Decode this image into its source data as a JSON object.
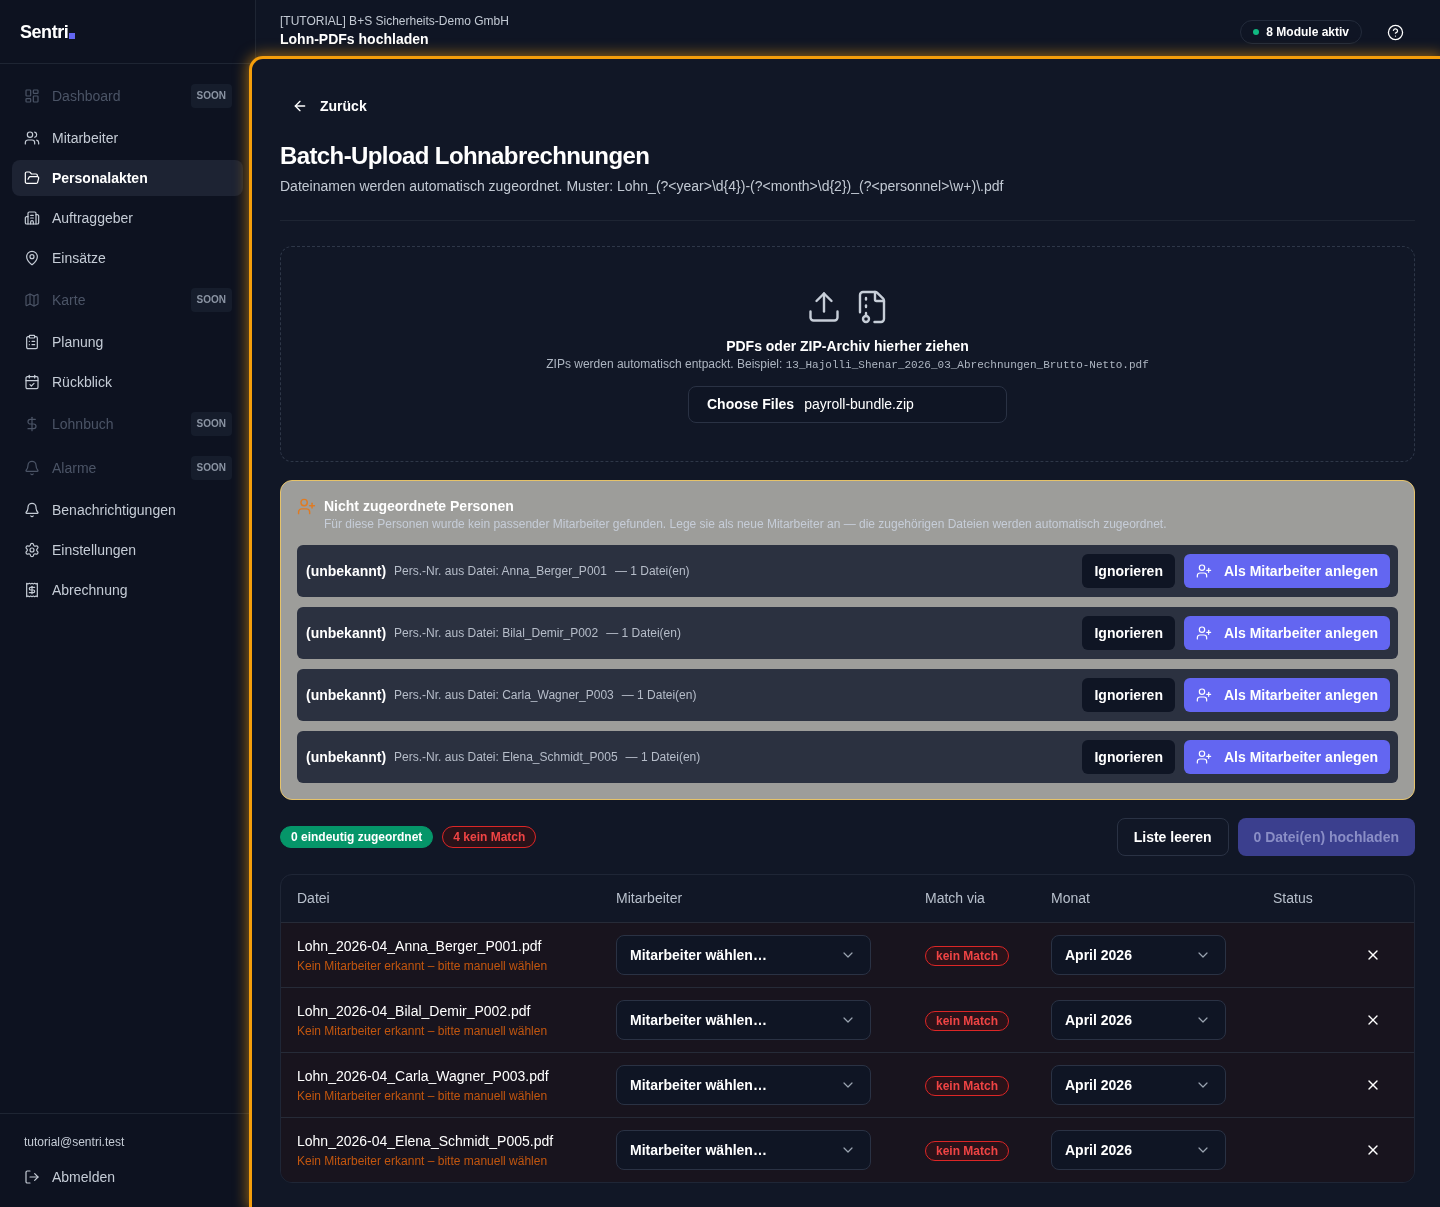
{
  "sidebar": {
    "logo": "Sentri",
    "items": [
      {
        "label": "Dashboard",
        "selected": false,
        "disabled": true,
        "badge": "SOON"
      },
      {
        "label": "Mitarbeiter",
        "selected": false,
        "disabled": false
      },
      {
        "label": "Personalakten",
        "selected": true,
        "disabled": false
      },
      {
        "label": "Auftraggeber",
        "selected": false,
        "disabled": false
      },
      {
        "label": "Einsätze",
        "selected": false,
        "disabled": false
      },
      {
        "label": "Karte",
        "selected": false,
        "disabled": true,
        "badge": "SOON"
      },
      {
        "label": "Planung",
        "selected": false,
        "disabled": false
      },
      {
        "label": "Rückblick",
        "selected": false,
        "disabled": false
      },
      {
        "label": "Lohnbuch",
        "selected": false,
        "disabled": true,
        "badge": "SOON"
      },
      {
        "label": "Alarme",
        "selected": false,
        "disabled": true,
        "badge": "SOON"
      },
      {
        "label": "Benachrichtigungen",
        "selected": false,
        "disabled": false
      },
      {
        "label": "Einstellungen",
        "selected": false,
        "disabled": false
      },
      {
        "label": "Abrechnung",
        "selected": false,
        "disabled": false
      }
    ],
    "user_email": "tutorial@sentri.test",
    "logout": "Abmelden"
  },
  "header": {
    "organization": "[TUTORIAL] B+S Sicherheits-Demo GmbH",
    "title": "Lohn-PDFs hochladen",
    "modules": "8 Module aktiv"
  },
  "page": {
    "back": "Zurück",
    "title": "Batch-Upload Lohnabrechnungen",
    "subtitle": "Dateinamen werden automatisch zugeordnet. Muster: Lohn_(?<year>\\d{4})-(?<month>\\d{2})_(?<personnel>\\w+)\\.pdf"
  },
  "dropzone": {
    "title": "PDFs oder ZIP-Archiv hierher ziehen",
    "hint": "ZIPs werden automatisch entpackt. Beispiel:",
    "example": "13_Hajolli_Shenar_2026_03_Abrechnungen_Brutto-Netto.pdf",
    "choose_button": "Choose Files",
    "file": "payroll-bundle.zip"
  },
  "unassigned": {
    "title": "Nicht zugeordnete Personen",
    "description": "Für diese Personen wurde kein passender Mitarbeiter gefunden. Lege sie als neue Mitarbeiter an — die zugehörigen Dateien werden automatisch zugeordnet.",
    "persons": [
      {
        "name": "(unbekannt)",
        "source": "Pers.-Nr. aus Datei: Anna_Berger_P001",
        "files": "— 1 Datei(en)",
        "ignore": "Ignorieren",
        "create": "Als Mitarbeiter anlegen"
      },
      {
        "name": "(unbekannt)",
        "source": "Pers.-Nr. aus Datei: Bilal_Demir_P002",
        "files": "— 1 Datei(en)",
        "ignore": "Ignorieren",
        "create": "Als Mitarbeiter anlegen"
      },
      {
        "name": "(unbekannt)",
        "source": "Pers.-Nr. aus Datei: Carla_Wagner_P003",
        "files": "— 1 Datei(en)",
        "ignore": "Ignorieren",
        "create": "Als Mitarbeiter anlegen"
      },
      {
        "name": "(unbekannt)",
        "source": "Pers.-Nr. aus Datei: Elena_Schmidt_P005",
        "files": "— 1 Datei(en)",
        "ignore": "Ignorieren",
        "create": "Als Mitarbeiter anlegen"
      }
    ]
  },
  "summary": {
    "badges": [
      {
        "label": "0 eindeutig zugeordnet",
        "kind": "matched"
      },
      {
        "label": "4 kein Match",
        "kind": "unmatched"
      }
    ],
    "clear_button": "Liste leeren",
    "upload_button": {
      "label": "0 Datei(en) hochladen",
      "disabled": true
    }
  },
  "table": {
    "columns": [
      "Datei",
      "Mitarbeiter",
      "Match via",
      "Monat",
      "Status"
    ],
    "rows": [
      {
        "file": "Lohn_2026-04_Anna_Berger_P001.pdf",
        "warning": "Kein Mitarbeiter erkannt – bitte manuell wählen",
        "employee": "Mitarbeiter wählen…",
        "match": "kein Match",
        "matched": false,
        "month": "April 2026"
      },
      {
        "file": "Lohn_2026-04_Bilal_Demir_P002.pdf",
        "warning": "Kein Mitarbeiter erkannt – bitte manuell wählen",
        "employee": "Mitarbeiter wählen…",
        "match": "kein Match",
        "matched": false,
        "month": "April 2026"
      },
      {
        "file": "Lohn_2026-04_Carla_Wagner_P003.pdf",
        "warning": "Kein Mitarbeiter erkannt – bitte manuell wählen",
        "employee": "Mitarbeiter wählen…",
        "match": "kein Match",
        "matched": false,
        "month": "April 2026"
      },
      {
        "file": "Lohn_2026-04_Elena_Schmidt_P005.pdf",
        "warning": "Kein Mitarbeiter erkannt – bitte manuell wählen",
        "employee": "Mitarbeiter wählen…",
        "match": "kein Match",
        "matched": false,
        "month": "April 2026"
      }
    ]
  }
}
